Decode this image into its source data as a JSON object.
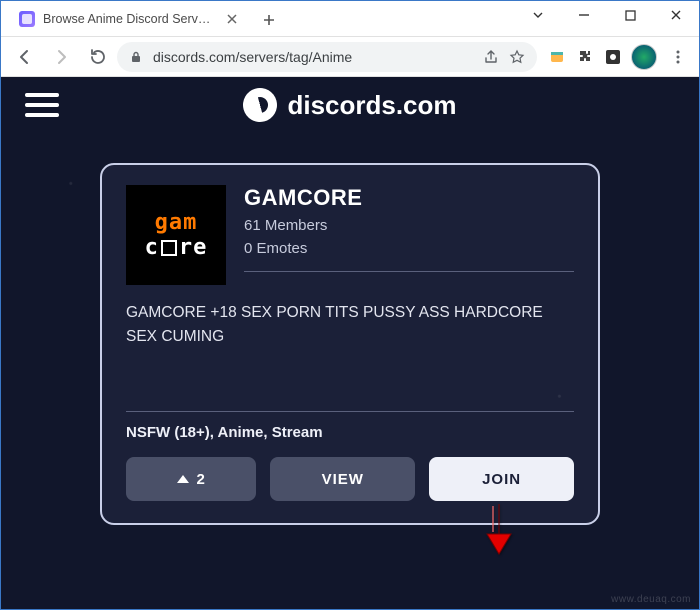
{
  "browser": {
    "tab_title": "Browse Anime Discord Servers | D",
    "url": "discords.com/servers/tag/Anime"
  },
  "site": {
    "brand": "discords.com"
  },
  "card": {
    "name": "GAMCORE",
    "members": "61 Members",
    "emotes": "0 Emotes",
    "description": "GAMCORE +18 SEX PORN TITS PUSSY ASS HARDCORE SEX CUMING",
    "tags": "NSFW (18+), Anime, Stream",
    "upvote_count": "2",
    "view_label": "VIEW",
    "join_label": "JOIN",
    "thumb_line1": "gam",
    "thumb_line2": "c",
    "thumb_line3": "re"
  },
  "watermark": "www.deuaq.com"
}
